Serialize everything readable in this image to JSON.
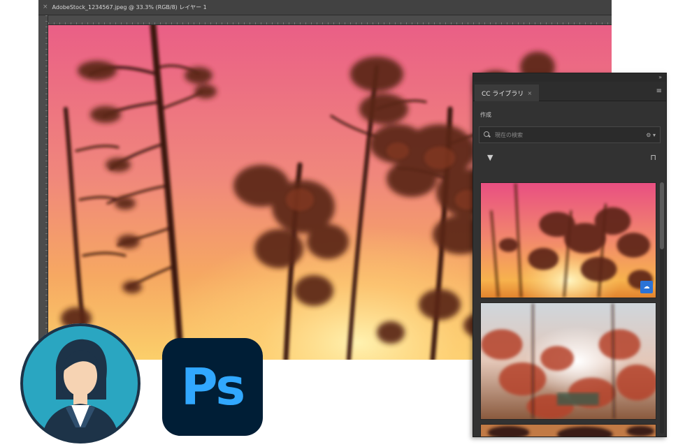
{
  "document": {
    "tab_title": "AdobeStock_1234567.jpeg @ 33.3% (RGB/8) レイヤー 1"
  },
  "libraries_panel": {
    "tab_label": "CC ライブラリ",
    "section_label": "作成",
    "search_placeholder": "現在の検索"
  },
  "app_icon": {
    "label": "Ps"
  },
  "colors": {
    "ps_icon_bg": "#001e36",
    "ps_icon_fg": "#31a8ff",
    "avatar_bg": "#2aa6c1",
    "badge_blue": "#2b73d6"
  },
  "icons": [
    "close-icon",
    "search-icon",
    "filter-icon",
    "view-toggle-icon",
    "panel-menu-icon",
    "user-avatar-icon",
    "cloud-badge-icon"
  ]
}
